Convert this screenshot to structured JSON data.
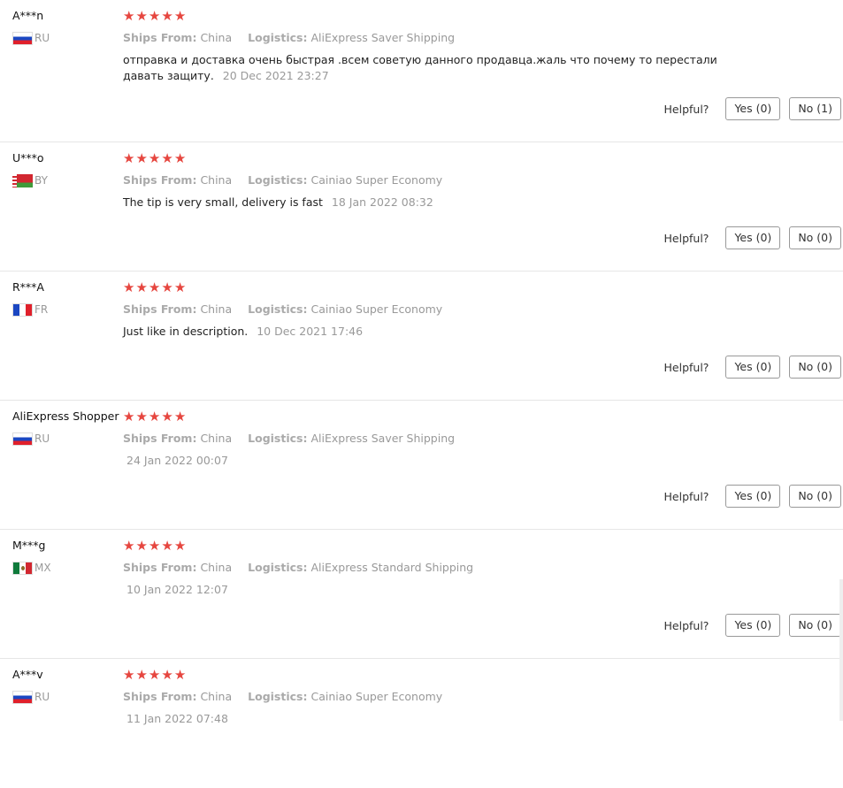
{
  "helpful_label": "Helpful?",
  "meta_labels": {
    "ships_from": "Ships From:",
    "logistics": "Logistics:"
  },
  "star_glyph": "★",
  "colors": {
    "star": "#e6463f",
    "muted": "#999999",
    "divider": "#e6e6e6"
  },
  "reviews": [
    {
      "user": "A***n",
      "country": "RU",
      "flag": "russia-flag-icon",
      "rating": 5,
      "ships_from": "China",
      "logistics": "AliExpress Saver Shipping",
      "text": "отправка и доставка очень быстрая .всем советую данного продавца.жаль что почему то перестали давать защиту.",
      "date": "20 Dec 2021 23:27",
      "yes": "Yes (0)",
      "no": "No (1)"
    },
    {
      "user": "U***o",
      "country": "BY",
      "flag": "belarus-flag-icon",
      "rating": 5,
      "ships_from": "China",
      "logistics": "Cainiao Super Economy",
      "text": "The tip is very small, delivery is fast",
      "date": "18 Jan 2022 08:32",
      "yes": "Yes (0)",
      "no": "No (0)"
    },
    {
      "user": "R***A",
      "country": "FR",
      "flag": "france-flag-icon",
      "rating": 5,
      "ships_from": "China",
      "logistics": "Cainiao Super Economy",
      "text": "Just like in description.",
      "date": "10 Dec 2021 17:46",
      "yes": "Yes (0)",
      "no": "No (0)"
    },
    {
      "user": "AliExpress Shopper",
      "country": "RU",
      "flag": "russia-flag-icon",
      "rating": 5,
      "ships_from": "China",
      "logistics": "AliExpress Saver Shipping",
      "text": "",
      "date": "24 Jan 2022 00:07",
      "yes": "Yes (0)",
      "no": "No (0)"
    },
    {
      "user": "M***g",
      "country": "MX",
      "flag": "mexico-flag-icon",
      "rating": 5,
      "ships_from": "China",
      "logistics": "AliExpress Standard Shipping",
      "text": "",
      "date": "10 Jan 2022 12:07",
      "yes": "Yes (0)",
      "no": "No (0)"
    },
    {
      "user": "A***v",
      "country": "RU",
      "flag": "russia-flag-icon",
      "rating": 5,
      "ships_from": "China",
      "logistics": "Cainiao Super Economy",
      "text": "",
      "date": "11 Jan 2022 07:48",
      "yes": "",
      "no": ""
    }
  ]
}
